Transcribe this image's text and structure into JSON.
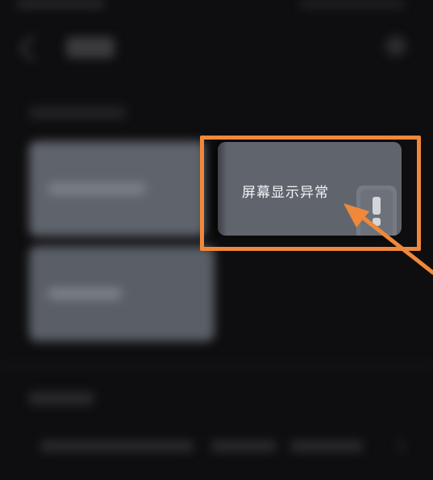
{
  "focus_card": {
    "label": "屏幕显示异常",
    "icon": "warning-icon"
  },
  "annotation": {
    "highlight_color": "#f0883a",
    "arrow_color": "#f0883a"
  }
}
